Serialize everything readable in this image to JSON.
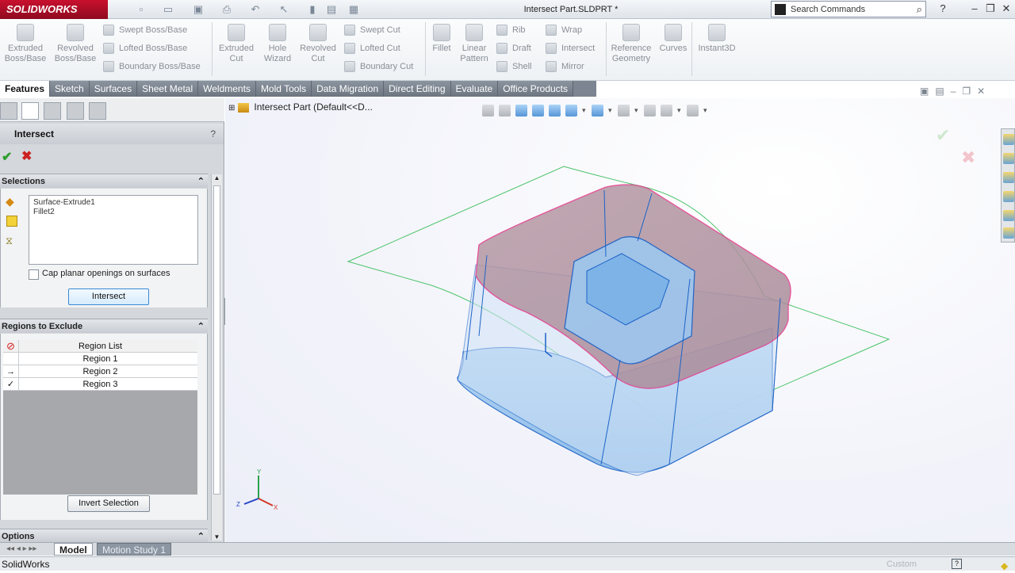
{
  "app": {
    "brand": "SOLIDWORKS",
    "document_title": "Intersect Part.SLDPRT *",
    "status": "SolidWorks",
    "status_right": "Custom"
  },
  "search": {
    "placeholder": "Search Commands"
  },
  "ribbon": {
    "big_buttons": [
      "Extruded Boss/Base",
      "Revolved Boss/Base",
      "Extruded Cut",
      "Hole Wizard",
      "Revolved Cut",
      "Fillet",
      "Linear Pattern",
      "Reference Geometry",
      "Curves",
      "Instant3D"
    ],
    "boss_column": [
      "Swept Boss/Base",
      "Lofted Boss/Base",
      "Boundary Boss/Base"
    ],
    "cut_column": [
      "Swept Cut",
      "Lofted Cut",
      "Boundary Cut"
    ],
    "feature_column_1": [
      "Rib",
      "Draft",
      "Shell"
    ],
    "feature_column_2": [
      "Wrap",
      "Intersect",
      "Mirror"
    ]
  },
  "tabs": [
    "Features",
    "Sketch",
    "Surfaces",
    "Sheet Metal",
    "Weldments",
    "Mold Tools",
    "Data Migration",
    "Direct Editing",
    "Evaluate",
    "Office Products"
  ],
  "property_manager": {
    "title": "Intersect",
    "help": "?",
    "selections": {
      "header": "Selections",
      "items": [
        "Surface-Extrude1",
        "Fillet2"
      ],
      "cap_label": "Cap planar openings on surfaces",
      "intersect_button": "Intersect"
    },
    "regions": {
      "header": "Regions to Exclude",
      "list_header": "Region List",
      "rows": [
        {
          "label": "Region  1",
          "marker": ""
        },
        {
          "label": "Region  2",
          "marker": "→"
        },
        {
          "label": "Region  3",
          "marker": "✓"
        }
      ],
      "invert_button": "Invert Selection"
    },
    "options_header": "Options"
  },
  "viewport": {
    "tree_label": "Intersect Part  (Default<<D..."
  },
  "bottom_tabs": [
    "Model",
    "Motion Study 1"
  ],
  "colors": {
    "title_red": "#c8102e",
    "surface_green": "#4cc36a",
    "body_blue": "#8dc0ee",
    "edge_magenta": "#e23b8a"
  }
}
